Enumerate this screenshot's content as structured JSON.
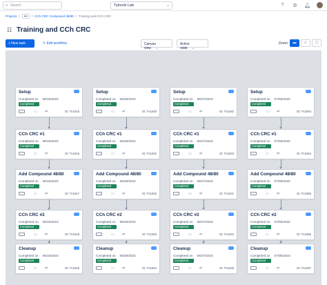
{
  "topbar": {
    "search_placeholder": "Search",
    "workspace": "Tykocki Lab",
    "icons": [
      "help-icon",
      "settings-icon",
      "notifications-icon",
      "avatar"
    ]
  },
  "breadcrumb": {
    "root": "Projects",
    "more": "•••",
    "project": "CCh CRC Compound 48/80",
    "current": "Training and CCh CRC"
  },
  "page": {
    "title": "Training and CCh CRC"
  },
  "toolbar": {
    "new_task": "+ New task",
    "edit_workflow": "✎  Edit workflow",
    "canvas_view": "Canvas view",
    "active_state": "Active state",
    "zoom_label": "Zoom:",
    "accent": "#0c66e4"
  },
  "columns": [
    {
      "cards": [
        {
          "title": "Setup",
          "done_label": "Completed on",
          "date": "06/16/2023",
          "status": "Completed",
          "id": "ID: TA1915"
        },
        {
          "title": "CCh CRC #1",
          "done_label": "Completed on",
          "date": "06/16/2023",
          "status": "Completed",
          "id": "ID: TA1916"
        },
        {
          "title": "Add Compound 48/80",
          "done_label": "Completed on",
          "date": "06/16/2023",
          "status": "Completed",
          "id": "ID: TA1917"
        },
        {
          "title": "CCh CRC #2",
          "done_label": "Completed on",
          "date": "06/16/2023",
          "status": "Completed",
          "id": "ID: TA1918"
        },
        {
          "title": "Cleanup",
          "done_label": "Completed on",
          "date": "06/16/2023",
          "status": "Completed",
          "id": "ID: TA1919"
        }
      ]
    },
    {
      "cards": [
        {
          "title": "Setup",
          "done_label": "Completed on",
          "date": "06/26/2023",
          "status": "Completed",
          "id": "ID: TA1930"
        },
        {
          "title": "CCh CRC #1",
          "done_label": "Completed on",
          "date": "06/26/2023",
          "status": "Completed",
          "id": "ID: TA1931"
        },
        {
          "title": "Add Compound 48/80",
          "done_label": "Completed on",
          "date": "06/26/2023",
          "status": "Completed",
          "id": "ID: TA1932"
        },
        {
          "title": "CCh CRC #2",
          "done_label": "Completed on",
          "date": "06/26/2023",
          "status": "Completed",
          "id": "ID: TA1933"
        },
        {
          "title": "Cleanup",
          "done_label": "Completed on",
          "date": "06/26/2023",
          "status": "Completed",
          "id": "ID: TA1934"
        }
      ]
    },
    {
      "cards": [
        {
          "title": "Setup",
          "done_label": "Completed on",
          "date": "06/27/2023",
          "status": "Completed",
          "id": "ID: TA1942"
        },
        {
          "title": "CCh CRC #1",
          "done_label": "Completed on",
          "date": "06/27/2023",
          "status": "Completed",
          "id": "ID: TA1943"
        },
        {
          "title": "Add Compound 48/80",
          "done_label": "Completed on",
          "date": "06/27/2023",
          "status": "Completed",
          "id": "ID: TA1941"
        },
        {
          "title": "CCh CRC #2",
          "done_label": "Completed on",
          "date": "06/27/2023",
          "status": "Completed",
          "id": "ID: TA1944"
        },
        {
          "title": "Cleanup",
          "done_label": "Completed on",
          "date": "06/27/2023",
          "status": "Completed",
          "id": "ID: TA1945"
        }
      ]
    },
    {
      "cards": [
        {
          "title": "Setup",
          "done_label": "Completed on",
          "date": "07/05/2023",
          "status": "Completed",
          "id": "ID: TA1953"
        },
        {
          "title": "CCh CRC #1",
          "done_label": "Completed on",
          "date": "07/05/2023",
          "status": "Completed",
          "id": "ID: TA1954"
        },
        {
          "title": "Add Compound 48/80",
          "done_label": "Completed on",
          "date": "07/05/2023",
          "status": "Completed",
          "id": "ID: TA1955"
        },
        {
          "title": "CCh CRC #2",
          "done_label": "Completed on",
          "date": "07/05/2023",
          "status": "Completed",
          "id": "ID: TA1956"
        },
        {
          "title": "Cleanup",
          "done_label": "Completed on",
          "date": "07/05/2023",
          "status": "Completed",
          "id": "ID: TA1957"
        }
      ]
    }
  ],
  "status_color": "#1f845a"
}
